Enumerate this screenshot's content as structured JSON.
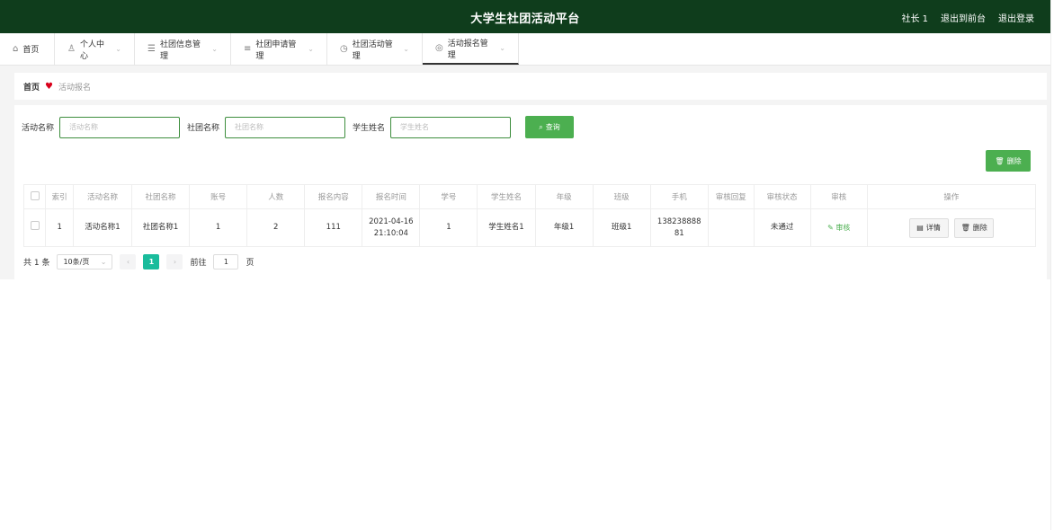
{
  "header": {
    "title": "大学生社团活动平台",
    "user": "社长 1",
    "back_to_front": "退出到前台",
    "logout": "退出登录"
  },
  "menu": [
    {
      "label": "首页",
      "icon": "home-icon",
      "glyph": "⌂",
      "has_chevron": false
    },
    {
      "label": "个人中心",
      "icon": "user-icon",
      "glyph": "♙",
      "has_chevron": true
    },
    {
      "label": "社团信息管理",
      "icon": "sliders-icon",
      "glyph": "☰",
      "has_chevron": true
    },
    {
      "label": "社团申请管理",
      "icon": "list-icon",
      "glyph": "≡",
      "has_chevron": true
    },
    {
      "label": "社团活动管理",
      "icon": "clock-icon",
      "glyph": "◷",
      "has_chevron": true
    },
    {
      "label": "活动报名管理",
      "icon": "globe-icon",
      "glyph": "◎",
      "has_chevron": true,
      "active": true
    }
  ],
  "breadcrumb": {
    "home": "首页",
    "current": "活动报名"
  },
  "search": {
    "activity_label": "活动名称",
    "activity_placeholder": "活动名称",
    "club_label": "社团名称",
    "club_placeholder": "社团名称",
    "student_label": "学生姓名",
    "student_placeholder": "学生姓名",
    "query_button": "查询"
  },
  "delete_button": "删除",
  "table": {
    "columns": [
      "索引",
      "活动名称",
      "社团名称",
      "账号",
      "人数",
      "报名内容",
      "报名时间",
      "学号",
      "学生姓名",
      "年级",
      "班级",
      "手机",
      "审核回复",
      "审核状态",
      "审核",
      "操作"
    ],
    "rows": [
      {
        "index": "1",
        "activity": "活动名称1",
        "club": "社团名称1",
        "account": "1",
        "people": "2",
        "content": "111",
        "time_date": "2021-04-16",
        "time_clock": "21:10:04",
        "student_no": "1",
        "student_name": "学生姓名1",
        "grade": "年级1",
        "class": "班级1",
        "phone_line1": "138238888",
        "phone_line2": "81",
        "reply": "",
        "status": "未通过",
        "audit": "审核",
        "detail": "详情",
        "delete": "删除"
      }
    ]
  },
  "pagination": {
    "total": "共 1 条",
    "page_size": "10条/页",
    "current_page": "1",
    "goto_label": "前往",
    "goto_value": "1",
    "page_suffix": "页"
  },
  "colors": {
    "topbar": "#0f3d1c",
    "accent": "#4caf50",
    "page_active": "#1abc9c"
  }
}
